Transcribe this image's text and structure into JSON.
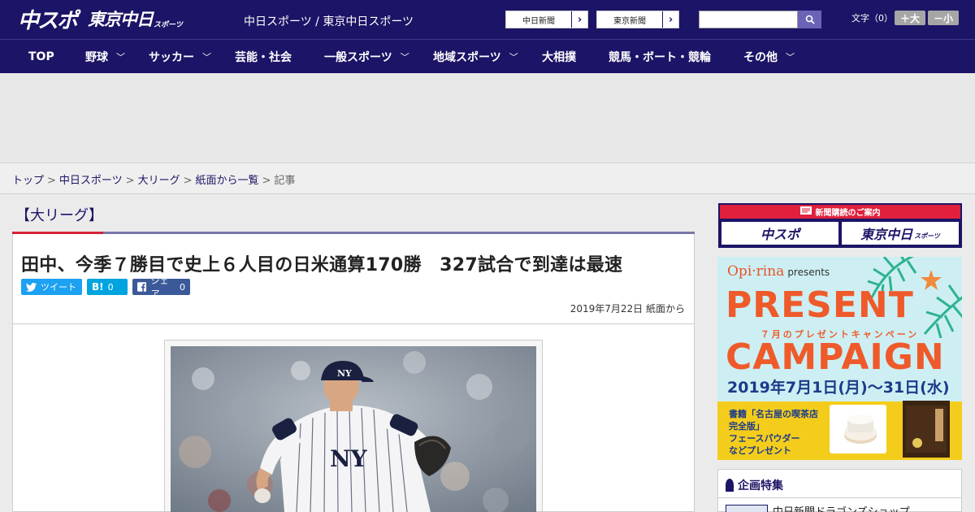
{
  "header": {
    "logo_main": "中スポ",
    "logo_tokyo": "東京中日",
    "logo_small": "スポーツ",
    "site_title": "中日スポーツ / 東京中日スポーツ",
    "links": [
      "中日新聞",
      "東京新聞"
    ],
    "search_placeholder": "",
    "fontsize_label": "文字（0）",
    "font_larger": "＋大",
    "font_smaller": "－小"
  },
  "nav": {
    "items": [
      {
        "label": "TOP",
        "dropdown": false
      },
      {
        "label": "野球",
        "dropdown": true
      },
      {
        "label": "サッカー",
        "dropdown": true
      },
      {
        "label": "芸能・社会",
        "dropdown": false
      },
      {
        "label": "一般スポーツ",
        "dropdown": true
      },
      {
        "label": "地域スポーツ",
        "dropdown": true
      },
      {
        "label": "大相撲",
        "dropdown": false
      },
      {
        "label": "競馬・ボート・競輪",
        "dropdown": false
      },
      {
        "label": "その他",
        "dropdown": true
      }
    ],
    "chevron": "﹀"
  },
  "breadcrumb": {
    "items": [
      "トップ",
      "中日スポーツ",
      "大リーグ",
      "紙面から一覧"
    ],
    "current": "記事",
    "separator": ">"
  },
  "article": {
    "section": "【大リーグ】",
    "headline": "田中、今季７勝目で史上６人目の日米通算170勝　327試合で到達は最速",
    "share": {
      "tweet_label": "ツイート",
      "hatena_label": "B!",
      "hatena_count": "0",
      "facebook_label": "シェア",
      "facebook_count": "0"
    },
    "dateline": "2019年7月22日 紙面から"
  },
  "sidebar": {
    "subscribe_title": "新聞購読のご案内",
    "subscribe_buttons": [
      "中スポ",
      "東京中日"
    ],
    "subscribe_small": "スポーツ",
    "campaign": {
      "brand": "Opi·rina",
      "presents": "presents",
      "title1": "PRESENT",
      "subtitle": "７月のプレゼントキャンペーン",
      "title2": "CAMPAIGN",
      "dates": "2019年7月1日(月)〜31日(水)",
      "text_line1": "書籍「名古屋の喫茶店",
      "text_line2": "完全版」",
      "text_line3": "フェースパウダー",
      "text_line4": "などプレゼント"
    },
    "feature_title": "企画特集",
    "feature_item": "中日新聞ドラゴンズショップ"
  },
  "colors": {
    "brand_navy": "#1c1466",
    "accent_red": "#d4233a",
    "twitter": "#1da1f2",
    "hatena": "#00a4de",
    "facebook": "#3b5998",
    "campaign_orange": "#ef5a2b"
  },
  "icons": {
    "search": "search-icon",
    "arrow": "chevron-right-icon",
    "twitter": "twitter-icon",
    "facebook": "facebook-icon"
  }
}
